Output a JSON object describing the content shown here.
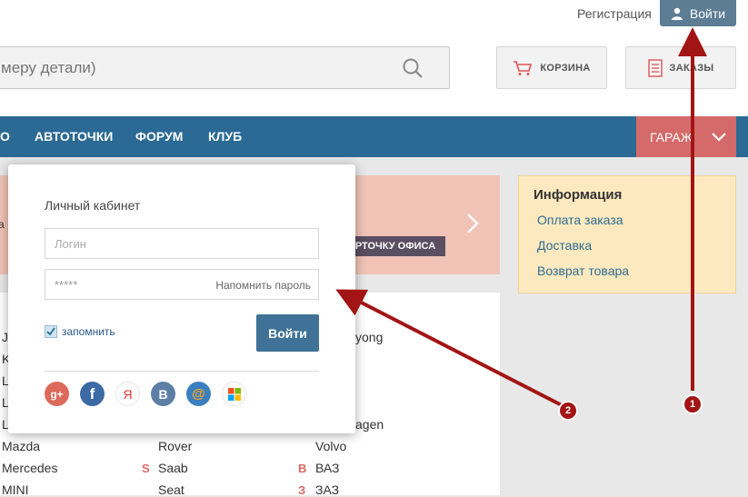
{
  "header": {
    "register_label": "Регистрация",
    "login_label": "Войти",
    "search_placeholder": "меру детали)",
    "cart_label": "КОРЗИНА",
    "orders_label": "ЗАКАЗЫ"
  },
  "nav": {
    "items": [
      "О",
      "АВТОТОЧКИ",
      "ФОРУМ",
      "КЛУБ"
    ],
    "garage_label": "ГАРАЖ"
  },
  "promo": {
    "edge_text": "а",
    "office_button": "РТОЧКУ ОФИСА"
  },
  "info": {
    "title": "Информация",
    "links": [
      "Оплата заказа",
      "Доставка",
      "Возврат товара"
    ]
  },
  "brands": {
    "col1": [
      "J",
      "K",
      "L",
      "L",
      "L",
      "Mazda",
      "Mercedes",
      "MINI"
    ],
    "col2": [
      "Rover",
      "Saab",
      "Seat"
    ],
    "col3": [
      "yong",
      "agen",
      "Volvo",
      "ВАЗ",
      "ЗАЗ"
    ],
    "letters": [
      "S",
      "В",
      "З"
    ]
  },
  "login_modal": {
    "title": "Личный кабинет",
    "login_placeholder": "Логин",
    "password_value": "*****",
    "remind_label": "Напомнить пароль",
    "remember_label": "запомнить",
    "submit_label": "Войти",
    "social": [
      "g+",
      "f",
      "Я",
      "В",
      "@",
      "win"
    ]
  },
  "callouts": {
    "one": "1",
    "two": "2"
  },
  "colors": {
    "nav_bg": "#2b6a94",
    "garage_bg": "#d56a6a",
    "arrow": "#a31414"
  }
}
